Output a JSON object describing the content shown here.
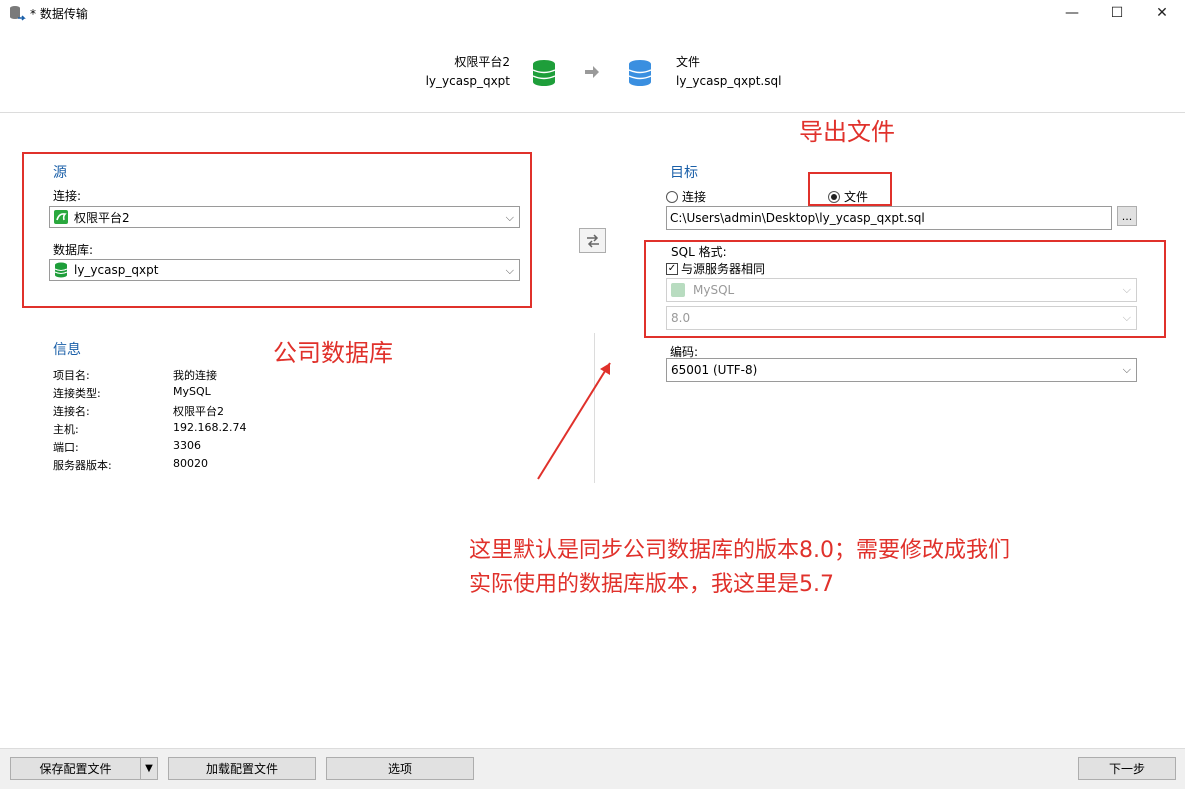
{
  "window": {
    "title": "* 数据传输",
    "min_glyph": "—",
    "max_glyph": "☐",
    "close_glyph": "✕"
  },
  "header": {
    "source_title": "权限平台2",
    "source_db": "ly_ycasp_qxpt",
    "target_title": "文件",
    "target_file": "ly_ycasp_qxpt.sql"
  },
  "source": {
    "heading": "源",
    "connection_label": "连接:",
    "connection_value": "权限平台2",
    "database_label": "数据库:",
    "database_value": "ly_ycasp_qxpt"
  },
  "info": {
    "heading": "信息",
    "rows": [
      {
        "key": "项目名:",
        "value": "我的连接"
      },
      {
        "key": "连接类型:",
        "value": "MySQL"
      },
      {
        "key": "连接名:",
        "value": "权限平台2"
      },
      {
        "key": "主机:",
        "value": "192.168.2.74"
      },
      {
        "key": "端口:",
        "value": "3306"
      },
      {
        "key": "服务器版本:",
        "value": "80020"
      }
    ]
  },
  "target": {
    "heading": "目标",
    "radio_connection": "连接",
    "radio_file": "文件",
    "selected": "file",
    "file_path": "C:\\Users\\admin\\Desktop\\ly_ycasp_qxpt.sql",
    "browse_label": "...",
    "sql_format_label": "SQL 格式:",
    "same_as_source_label": "与源服务器相同",
    "same_as_source_checked": true,
    "server_type_value": "MySQL",
    "version_value": "8.0",
    "encoding_label": "编码:",
    "encoding_value": "65001 (UTF-8)"
  },
  "annotations": {
    "export_file": "导出文件",
    "company_db": "公司数据库",
    "note_line1": "这里默认是同步公司数据库的版本8.0；需要修改成我们",
    "note_line2": "实际使用的数据库版本，我这里是5.7"
  },
  "footer": {
    "save_profile": "保存配置文件",
    "load_profile": "加载配置文件",
    "options": "选项",
    "next": "下一步"
  },
  "colors": {
    "accent_blue": "#1a5fa8",
    "annotation_red": "#e0312b",
    "db_green": "#1e9e3a",
    "db_blue": "#3a8fe0"
  }
}
